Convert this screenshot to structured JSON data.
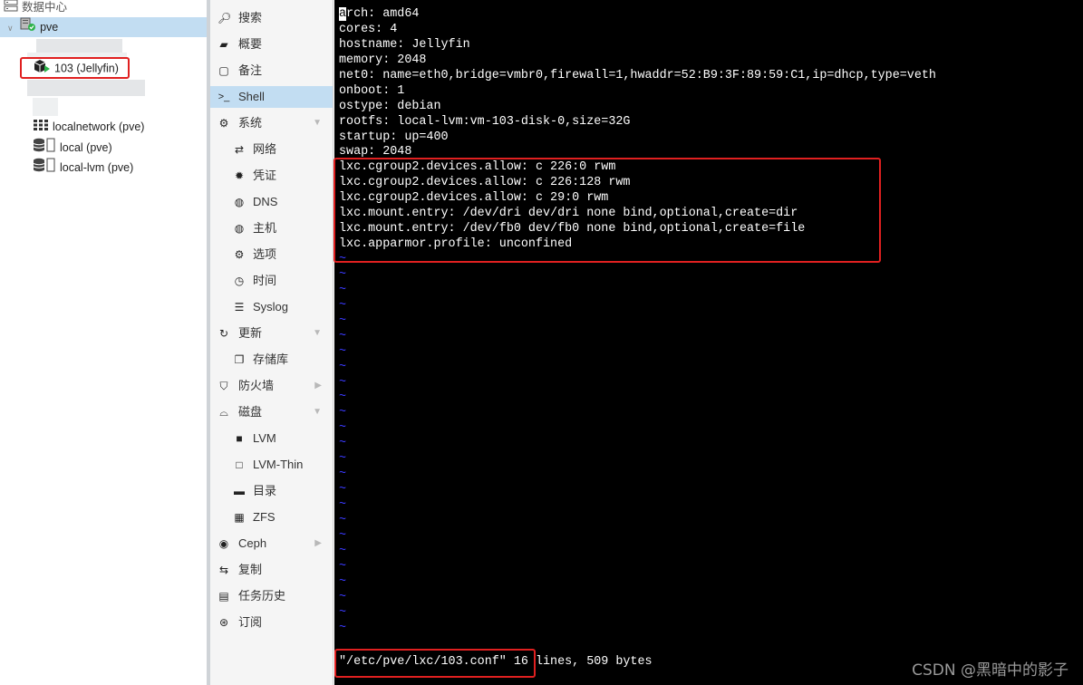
{
  "tree": {
    "datacenter": "数据中心",
    "node": "pve",
    "container": "103 (Jellyfin)",
    "items": [
      {
        "label": "localnetwork (pve)",
        "icon": "network-grid-icon"
      },
      {
        "label": "local (pve)",
        "icon": "storage-icon"
      },
      {
        "label": "local-lvm (pve)",
        "icon": "storage-icon"
      }
    ]
  },
  "nav": {
    "items": [
      {
        "label": "搜索",
        "icon": "search-icon"
      },
      {
        "label": "概要",
        "icon": "book-icon"
      },
      {
        "label": "备注",
        "icon": "note-icon"
      },
      {
        "label": "Shell",
        "icon": "terminal-icon"
      },
      {
        "label": "系统",
        "icon": "gears-icon"
      },
      {
        "label": "网络",
        "icon": "exchange-icon"
      },
      {
        "label": "凭证",
        "icon": "certificate-icon"
      },
      {
        "label": "DNS",
        "icon": "globe-icon"
      },
      {
        "label": "主机",
        "icon": "globe-icon"
      },
      {
        "label": "选项",
        "icon": "gear-icon"
      },
      {
        "label": "时间",
        "icon": "clock-icon"
      },
      {
        "label": "Syslog",
        "icon": "list-icon"
      },
      {
        "label": "更新",
        "icon": "refresh-icon"
      },
      {
        "label": "存储库",
        "icon": "files-icon"
      },
      {
        "label": "防火墙",
        "icon": "shield-icon"
      },
      {
        "label": "磁盘",
        "icon": "hdd-icon"
      },
      {
        "label": "LVM",
        "icon": "square-icon"
      },
      {
        "label": "LVM-Thin",
        "icon": "square-outline-icon"
      },
      {
        "label": "目录",
        "icon": "folder-icon"
      },
      {
        "label": "ZFS",
        "icon": "th-large-icon"
      },
      {
        "label": "Ceph",
        "icon": "ceph-icon"
      },
      {
        "label": "复制",
        "icon": "retweet-icon"
      },
      {
        "label": "任务历史",
        "icon": "list-alt-icon"
      },
      {
        "label": "订阅",
        "icon": "support-icon"
      }
    ]
  },
  "terminal": {
    "lines": [
      "arch: amd64",
      "cores: 4",
      "hostname: Jellyfin",
      "memory: 2048",
      "net0: name=eth0,bridge=vmbr0,firewall=1,hwaddr=52:B9:3F:89:59:C1,ip=dhcp,type=veth",
      "onboot: 1",
      "ostype: debian",
      "rootfs: local-lvm:vm-103-disk-0,size=32G",
      "startup: up=400",
      "swap: 2048",
      "lxc.cgroup2.devices.allow: c 226:0 rwm",
      "lxc.cgroup2.devices.allow: c 226:128 rwm",
      "lxc.cgroup2.devices.allow: c 29:0 rwm",
      "lxc.mount.entry: /dev/dri dev/dri none bind,optional,create=dir",
      "lxc.mount.entry: /dev/fb0 dev/fb0 none bind,optional,create=file",
      "lxc.apparmor.profile: unconfined"
    ],
    "tilde": "~",
    "tilde_count": 25,
    "status_file": "\"/etc/pve/lxc/103.conf\"",
    "status_info": " 16 lines, 509 bytes"
  },
  "watermark": "CSDN @黑暗中的影子",
  "colors": {
    "selection": "#c2ddf2",
    "highlight_box": "#e02020",
    "terminal_bg": "#000000",
    "tilde": "#3a3aff",
    "running_status": "#2db34a"
  }
}
